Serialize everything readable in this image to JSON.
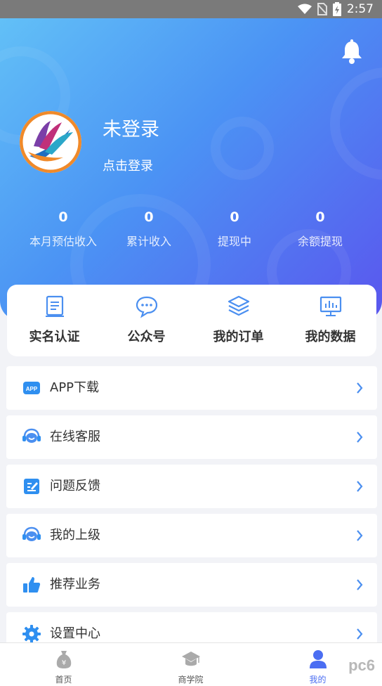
{
  "status_bar": {
    "time": "2:57"
  },
  "header": {
    "user_name": "未登录",
    "login_prompt": "点击登录",
    "stats": [
      {
        "value": "0",
        "label": "本月预估收入"
      },
      {
        "value": "0",
        "label": "累计收入"
      },
      {
        "value": "0",
        "label": "提现中"
      },
      {
        "value": "0",
        "label": "余额提现"
      }
    ]
  },
  "quick_actions": [
    {
      "label": "实名认证",
      "icon": "id-card-icon"
    },
    {
      "label": "公众号",
      "icon": "chat-bubble-icon"
    },
    {
      "label": "我的订单",
      "icon": "layers-icon"
    },
    {
      "label": "我的数据",
      "icon": "chart-monitor-icon"
    }
  ],
  "menu": [
    {
      "label": "APP下载",
      "icon": "app-icon"
    },
    {
      "label": "在线客服",
      "icon": "headset-icon"
    },
    {
      "label": "问题反馈",
      "icon": "feedback-edit-icon"
    },
    {
      "label": "我的上级",
      "icon": "headset-icon"
    },
    {
      "label": "推荐业务",
      "icon": "thumbs-up-icon"
    },
    {
      "label": "设置中心",
      "icon": "gear-icon"
    }
  ],
  "tab_bar": {
    "tabs": [
      {
        "label": "首页",
        "icon": "money-bag-icon"
      },
      {
        "label": "商学院",
        "icon": "graduation-cap-icon"
      },
      {
        "label": "我的",
        "icon": "person-icon",
        "active": true
      }
    ]
  },
  "watermark": "pc6",
  "colors": {
    "accent": "#4b8ff0",
    "gradient_start": "#62c0f7",
    "gradient_end": "#5a56ee"
  }
}
